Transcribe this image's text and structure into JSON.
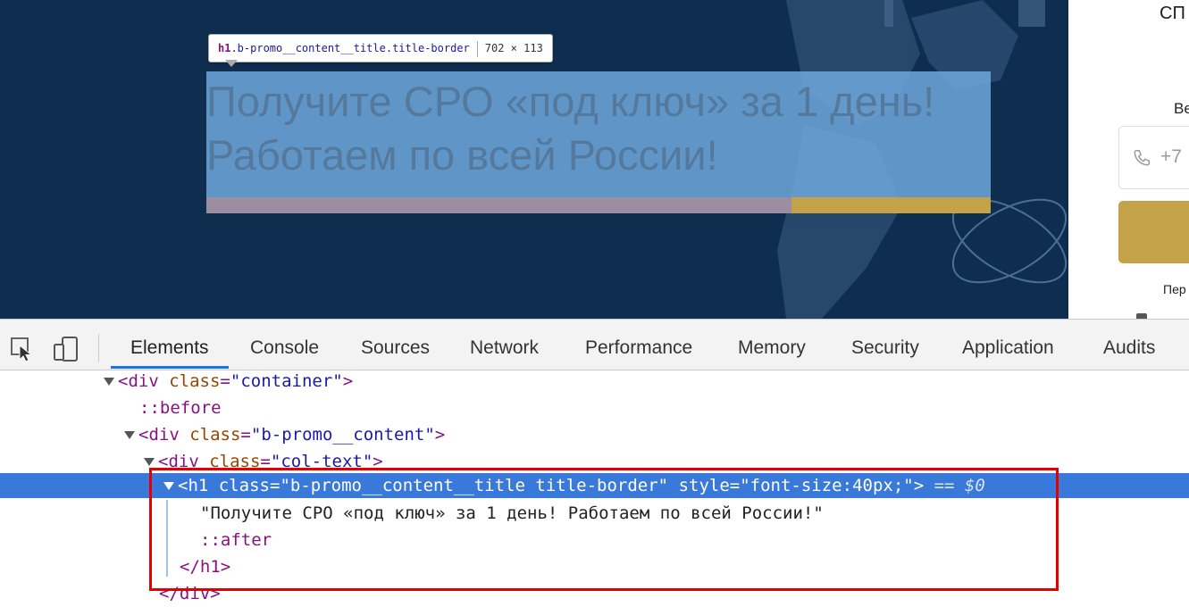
{
  "page": {
    "right_panel": {
      "abbr": "СП",
      "label": "Ве",
      "phone_placeholder": "+7",
      "note": "Пер"
    },
    "tooltip": {
      "tag": "h1",
      "classes": ".b-promo__content__title.title-border",
      "dims": "702 × 113"
    },
    "heading": "Получите СРО «под ключ» за 1 день! Работаем по всей России!",
    "colors": {
      "page_bg": "#0f2e4f",
      "highlight": "#6fa8dc",
      "accent_gold": "#c4a24a"
    }
  },
  "devtools": {
    "toolbar": {
      "inspect_icon": "inspect-element-icon",
      "device_icon": "device-toolbar-icon",
      "tabs": [
        {
          "label": "Elements",
          "active": true
        },
        {
          "label": "Console"
        },
        {
          "label": "Sources"
        },
        {
          "label": "Network"
        },
        {
          "label": "Performance"
        },
        {
          "label": "Memory"
        },
        {
          "label": "Security"
        },
        {
          "label": "Application"
        },
        {
          "label": "Audits"
        }
      ]
    },
    "tree": {
      "l1_tag_open": "<div",
      "l1_attr": "class",
      "l1_val": "\"container\"",
      "l1_tag_close": ">",
      "l2_pseudo": "::before",
      "l3_tag_open": "<div",
      "l3_attr": "class",
      "l3_val": "\"b-promo__content\"",
      "l3_tag_close": ">",
      "l4_tag_open": "<div",
      "l4_attr": "class",
      "l4_val": "\"col-text\"",
      "l4_tag_close": ">",
      "sel_dots": "…",
      "sel_tag_open": "<h1",
      "sel_attr1": "class",
      "sel_val1": "\"b-promo__content__title title-border\"",
      "sel_attr2": "style",
      "sel_val2": "\"font-size:40px;\"",
      "sel_tag_close": ">",
      "sel_eq": "== $0",
      "text_node": "\"Получите СРО «под ключ» за 1 день! Работаем по всей России!\"",
      "after_pseudo": "::after",
      "h1_close": "</h1>",
      "div_close": "</div>"
    }
  }
}
